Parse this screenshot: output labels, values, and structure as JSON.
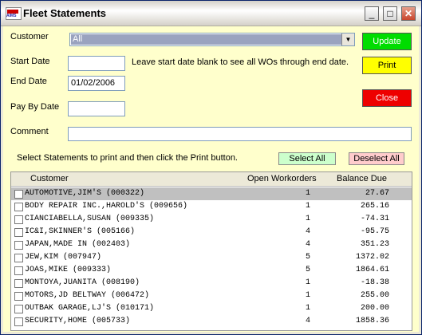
{
  "window": {
    "title": "Fleet Statements",
    "icon_text": "AIMS",
    "controls": {
      "minimize": "_",
      "maximize": "□",
      "close": "✕"
    }
  },
  "form": {
    "customer_label": "Customer",
    "customer_value": "All",
    "start_date_label": "Start Date",
    "start_date_value": "",
    "start_date_hint": "Leave start date blank to see all WOs through end date.",
    "end_date_label": "End Date",
    "end_date_value": "01/02/2006",
    "pay_by_label": "Pay By Date",
    "pay_by_value": "",
    "comment_label": "Comment",
    "comment_value": ""
  },
  "buttons": {
    "update": "Update",
    "print": "Print",
    "close": "Close",
    "select_all": "Select All",
    "deselect_all": "Deselect All"
  },
  "colors": {
    "background": "#ffffcc",
    "update": "#00dd00",
    "print": "#ffff00",
    "close": "#ee0000",
    "select_all": "#ccffcc",
    "deselect_all": "#ffcccc"
  },
  "instructions": "Select Statements to print and then click the Print button.",
  "table": {
    "headers": {
      "customer": "Customer",
      "open_workorders": "Open Workorders",
      "balance_due": "Balance Due"
    },
    "rows": [
      {
        "customer": "AUTOMOTIVE,JIM'S (000322)",
        "open": "1",
        "balance": "27.67",
        "selected": true
      },
      {
        "customer": "BODY REPAIR INC.,HAROLD'S (009656)",
        "open": "1",
        "balance": "265.16"
      },
      {
        "customer": "CIANCIABELLA,SUSAN (009335)",
        "open": "1",
        "balance": "-74.31"
      },
      {
        "customer": "IC&I,SKINNER'S (005166)",
        "open": "4",
        "balance": "-95.75"
      },
      {
        "customer": "JAPAN,MADE IN (002403)",
        "open": "4",
        "balance": "351.23"
      },
      {
        "customer": "JEW,KIM (007947)",
        "open": "5",
        "balance": "1372.02"
      },
      {
        "customer": "JOAS,MIKE (009333)",
        "open": "5",
        "balance": "1864.61"
      },
      {
        "customer": "MONTOYA,JUANITA (008190)",
        "open": "1",
        "balance": "-18.38"
      },
      {
        "customer": "MOTORS,JD BELTWAY (006472)",
        "open": "1",
        "balance": "255.00"
      },
      {
        "customer": "OUTBAK GARAGE,LJ'S (010171)",
        "open": "1",
        "balance": "200.00"
      },
      {
        "customer": "SECURITY,HOME (005733)",
        "open": "4",
        "balance": "1858.36"
      }
    ]
  }
}
